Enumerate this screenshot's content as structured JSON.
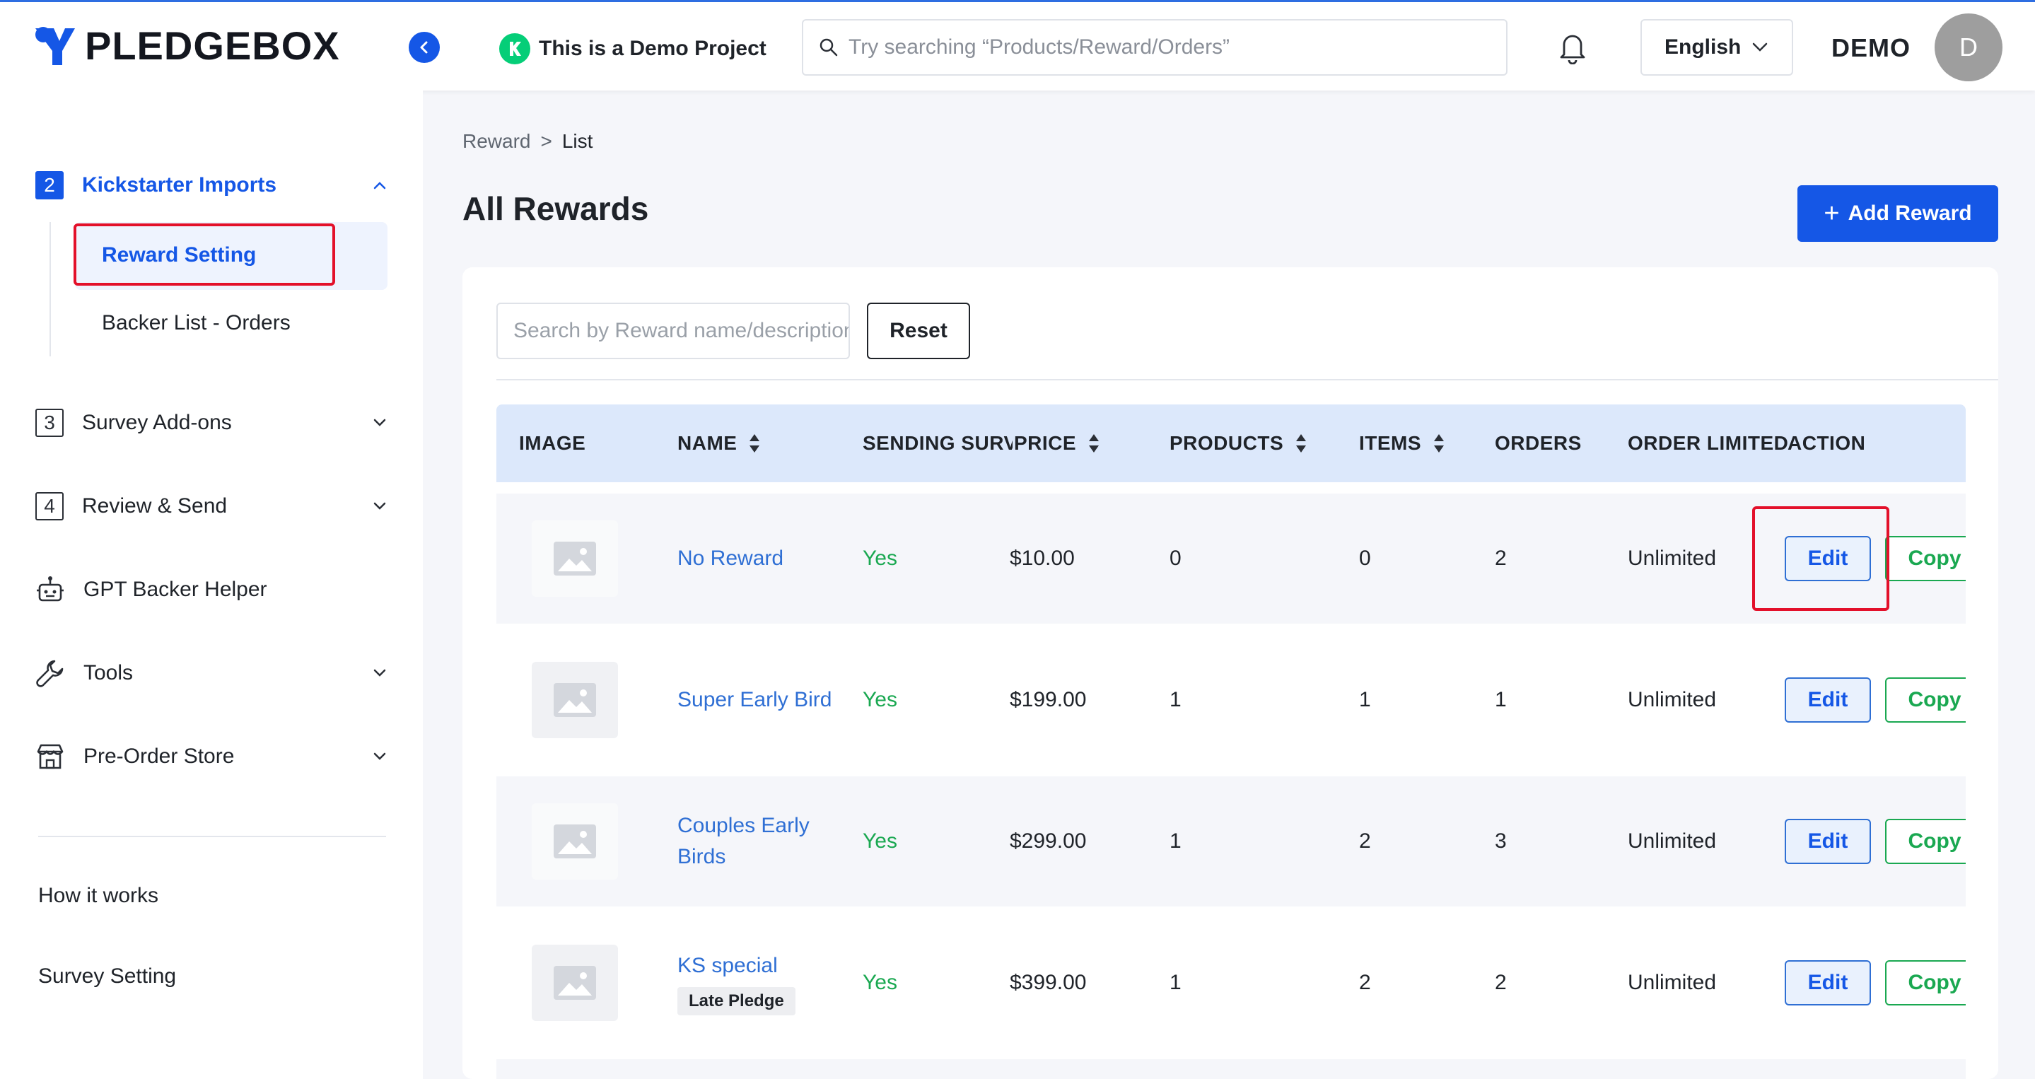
{
  "header": {
    "logo_text": "PLEDGEBOX",
    "project_label": "This is a Demo Project",
    "search_placeholder": "Try searching “Products/Reward/Orders”",
    "language": "English",
    "user_name": "DEMO",
    "avatar_initial": "D"
  },
  "sidebar": {
    "kickstarter": {
      "step": "2",
      "label": "Kickstarter Imports"
    },
    "sub_items": [
      "Reward Setting",
      "Backer List - Orders"
    ],
    "items": [
      {
        "step": "3",
        "label": "Survey Add-ons"
      },
      {
        "step": "4",
        "label": "Review & Send"
      },
      {
        "label": "GPT Backer Helper",
        "icon": "robot-icon"
      },
      {
        "label": "Tools",
        "icon": "wrench-icon"
      },
      {
        "label": "Pre-Order Store",
        "icon": "store-icon"
      }
    ],
    "bottom_links": [
      "How it works",
      "Survey Setting"
    ]
  },
  "breadcrumb": {
    "parent": "Reward",
    "separator": ">",
    "current": "List"
  },
  "page": {
    "title": "All Rewards",
    "add_button": "Add Reward"
  },
  "filters": {
    "search_placeholder": "Search by Reward name/description",
    "reset_label": "Reset"
  },
  "table": {
    "columns": [
      "IMAGE",
      "NAME",
      "SENDING SURVEY",
      "PRICE",
      "PRODUCTS",
      "ITEMS",
      "ORDERS",
      "ORDER LIMITED",
      "ACTION"
    ],
    "rows": [
      {
        "name": "No Reward",
        "tag": "",
        "sending_survey": "Yes",
        "price": "$10.00",
        "products": "0",
        "items": "0",
        "orders": "2",
        "order_limited": "Unlimited"
      },
      {
        "name": "Super Early Bird",
        "tag": "",
        "sending_survey": "Yes",
        "price": "$199.00",
        "products": "1",
        "items": "1",
        "orders": "1",
        "order_limited": "Unlimited"
      },
      {
        "name": "Couples Early Birds",
        "tag": "",
        "sending_survey": "Yes",
        "price": "$299.00",
        "products": "1",
        "items": "2",
        "orders": "3",
        "order_limited": "Unlimited"
      },
      {
        "name": "KS special",
        "tag": "Late Pledge",
        "sending_survey": "Yes",
        "price": "$399.00",
        "products": "1",
        "items": "2",
        "orders": "2",
        "order_limited": "Unlimited"
      }
    ],
    "edit_label": "Edit",
    "copy_label": "Copy"
  },
  "colors": {
    "primary": "#1557e6",
    "success": "#1aa851",
    "highlight": "#e3102a",
    "header_row": "#dce8fb"
  }
}
